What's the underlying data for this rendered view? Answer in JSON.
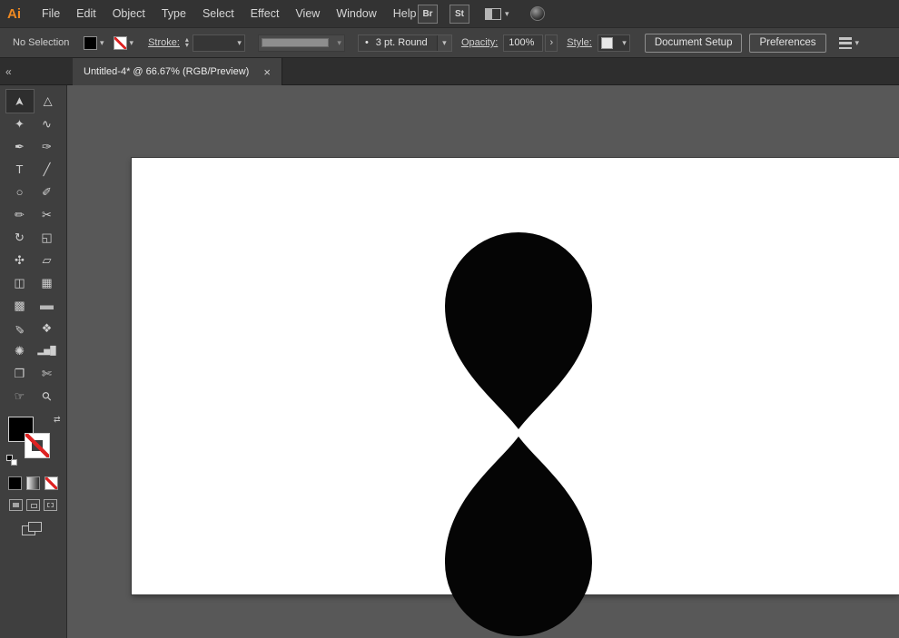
{
  "app": {
    "logo": "Ai"
  },
  "menubar": {
    "items": [
      "File",
      "Edit",
      "Object",
      "Type",
      "Select",
      "Effect",
      "View",
      "Window",
      "Help"
    ],
    "bridge_button": "Br",
    "stock_button": "St"
  },
  "controlbar": {
    "selection_status": "No Selection",
    "stroke_label": "Stroke:",
    "brush_value": "3 pt. Round",
    "opacity_label": "Opacity:",
    "opacity_value": "100%",
    "style_label": "Style:",
    "document_setup_button": "Document Setup",
    "preferences_button": "Preferences"
  },
  "document_tab": {
    "title": "Untitled-4* @ 66.67% (RGB/Preview)",
    "close": "×"
  },
  "icons": {
    "caret_down": "▾",
    "collapse_left": "«",
    "stepper_up": "▴",
    "stepper_down": "▾",
    "panel_arrow": "›",
    "swap_arrows": "⇄",
    "brush_dot": "•"
  },
  "colors": {
    "fill_swatch": "#000000",
    "none_indicator": "#dd2222",
    "app_logo_orange": "#ee8922",
    "canvas_bg": "#585858",
    "artboard": "#ffffff",
    "artwork": "#000000"
  },
  "tools": [
    {
      "name": "selection-tool",
      "glyph": "➤"
    },
    {
      "name": "direct-selection-tool",
      "glyph": "▷"
    },
    {
      "name": "magic-wand-tool",
      "glyph": "✦"
    },
    {
      "name": "lasso-tool",
      "glyph": "∿"
    },
    {
      "name": "pen-tool",
      "glyph": "✒"
    },
    {
      "name": "curvature-tool",
      "glyph": "✑"
    },
    {
      "name": "type-tool",
      "glyph": "T"
    },
    {
      "name": "line-segment-tool",
      "glyph": "╱"
    },
    {
      "name": "ellipse-tool",
      "glyph": "○"
    },
    {
      "name": "paintbrush-tool",
      "glyph": "✐"
    },
    {
      "name": "pencil-tool",
      "glyph": "✏"
    },
    {
      "name": "scissors-tool",
      "glyph": "✂"
    },
    {
      "name": "rotate-tool",
      "glyph": "↻"
    },
    {
      "name": "scale-tool",
      "glyph": "◱"
    },
    {
      "name": "width-tool",
      "glyph": "✣"
    },
    {
      "name": "free-transform-tool",
      "glyph": "▱"
    },
    {
      "name": "shape-builder-tool",
      "glyph": "◫"
    },
    {
      "name": "perspective-grid-tool",
      "glyph": "▦"
    },
    {
      "name": "mesh-tool",
      "glyph": "▩"
    },
    {
      "name": "gradient-tool",
      "glyph": "▬"
    },
    {
      "name": "eyedropper-tool",
      "glyph": "✎"
    },
    {
      "name": "blend-tool",
      "glyph": "❖"
    },
    {
      "name": "symbol-sprayer-tool",
      "glyph": "✺"
    },
    {
      "name": "column-graph-tool",
      "glyph": "▂▅█"
    },
    {
      "name": "artboard-tool",
      "glyph": "❐"
    },
    {
      "name": "slice-tool",
      "glyph": "✄"
    },
    {
      "name": "hand-tool",
      "glyph": "☞"
    },
    {
      "name": "zoom-tool",
      "glyph": "⚲"
    }
  ]
}
